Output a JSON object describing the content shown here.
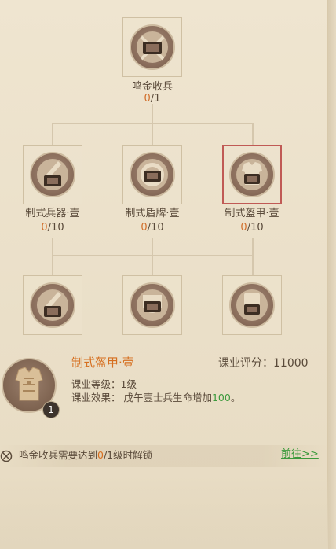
{
  "tree": {
    "top": {
      "label": "鸣金收兵",
      "current": "0",
      "max": "1",
      "icon": "scroll-crossed-icon"
    },
    "row2": [
      {
        "label": "制式兵器·壹",
        "current": "0",
        "max": "10",
        "icon": "weapon-scroll-icon"
      },
      {
        "label": "制式盾牌·壹",
        "current": "0",
        "max": "10",
        "icon": "shield-scroll-icon"
      },
      {
        "label": "制式盔甲·壹",
        "current": "0",
        "max": "10",
        "icon": "armor-scroll-icon",
        "selected": true
      }
    ],
    "row3": [
      {
        "icon": "weapon-scroll-icon"
      },
      {
        "icon": "shield-scroll-icon"
      },
      {
        "icon": "armor-scroll-icon"
      }
    ]
  },
  "detail": {
    "title": "制式盔甲·壹",
    "score_label": "课业评分：",
    "score_value": "11000",
    "level_line": "课业等级：1级",
    "effect_prefix": "课业效果：  戊午壹士兵生命增加",
    "effect_value": "100",
    "effect_suffix": "。",
    "badge": "1",
    "icon": "armor-icon"
  },
  "unlock": {
    "text_prefix": "鸣金收兵需要达到",
    "text_value": "0",
    "text_suffix": "/1级时解锁",
    "goto": "前往>>",
    "icon": "lock-icon"
  },
  "colors": {
    "accent_orange": "#d66e1e",
    "accent_green": "#3c9a3c",
    "selected_border": "#c05a55"
  }
}
